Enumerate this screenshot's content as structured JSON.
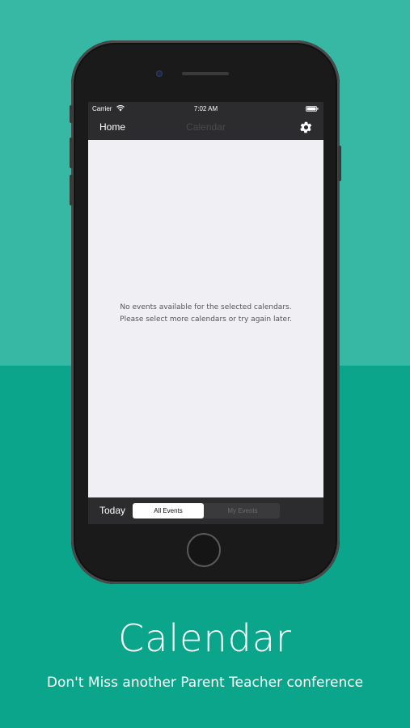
{
  "status_bar": {
    "carrier": "Carrier",
    "time": "7:02 AM",
    "wifi_icon": "wifi-icon",
    "battery_icon": "battery-icon"
  },
  "nav_bar": {
    "home_label": "Home",
    "title": "Calendar",
    "settings_icon": "gear-icon"
  },
  "content": {
    "empty_line1": "No events available for the selected calendars.",
    "empty_line2": "Please select more calendars or try again later."
  },
  "bottom_bar": {
    "today_label": "Today",
    "segments": [
      {
        "label": "All Events",
        "selected": true
      },
      {
        "label": "My Events",
        "selected": false
      }
    ]
  },
  "caption": {
    "title": "Calendar",
    "subtitle": "Don't Miss another Parent Teacher conference"
  },
  "colors": {
    "background_top": "#36b8a4",
    "background_bottom": "#0aa58b",
    "bar_dark": "#2c2c2e",
    "screen_bg": "#efeff4"
  }
}
